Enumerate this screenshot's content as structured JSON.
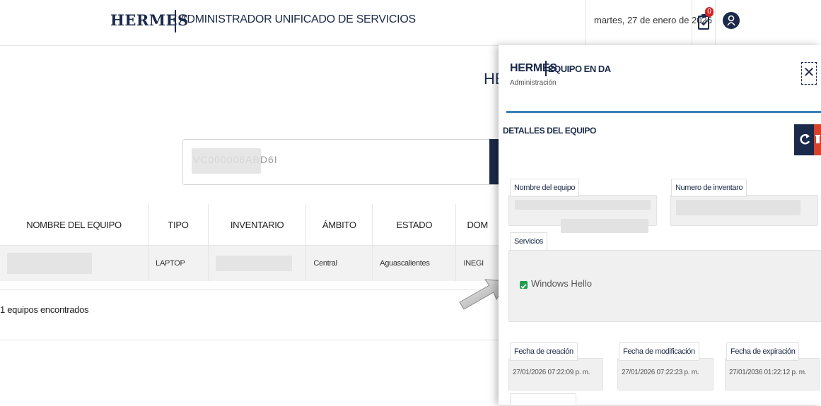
{
  "header": {
    "brand": "HERMES",
    "title": "ADMINISTRADOR UNIFICADO DE SERVICIOS",
    "date": "martes, 27 de enero de 2026",
    "notification_count": "0"
  },
  "main": {
    "heading_partial": "HE",
    "search": {
      "value": "VC000006ABD6I"
    },
    "table": {
      "columns": [
        "NOMBRE DEL EQUIPO",
        "TIPO",
        "INVENTARIO",
        "ÁMBITO",
        "ESTADO",
        "DOM"
      ],
      "rows": [
        {
          "tipo": "LAPTOP",
          "ambito": "Central",
          "estado": "Aguascalientes",
          "dom": "INEGI"
        }
      ]
    },
    "result_count": "1 equipos encontrados"
  },
  "drawer": {
    "brand": "HERMES",
    "title": "EQUIPO EN DA",
    "subtitle": "Administración",
    "section": "DETALLES DEL EQUIPO",
    "fields": {
      "device_name_label": "Nombre del equipo",
      "inventory_label": "Numero de inventaro",
      "services_label": "Servicios",
      "services": [
        {
          "name": "Windows Hello",
          "checked": true
        }
      ],
      "created_label": "Fecha de creación",
      "created_value": "27/01/2026 07:22:09 p. m.",
      "modified_label": "Fecha de modificación",
      "modified_value": "27/01/2026 07:22:23 p. m.",
      "expiration_label": "Fecha de expiración",
      "expiration_value": "27/01/2036 01:22:12 p. m."
    }
  },
  "colors": {
    "navy": "#1b2a4a",
    "accent_line": "#3a7fb6",
    "danger": "#d9412d",
    "check": "#1f9d4c"
  }
}
